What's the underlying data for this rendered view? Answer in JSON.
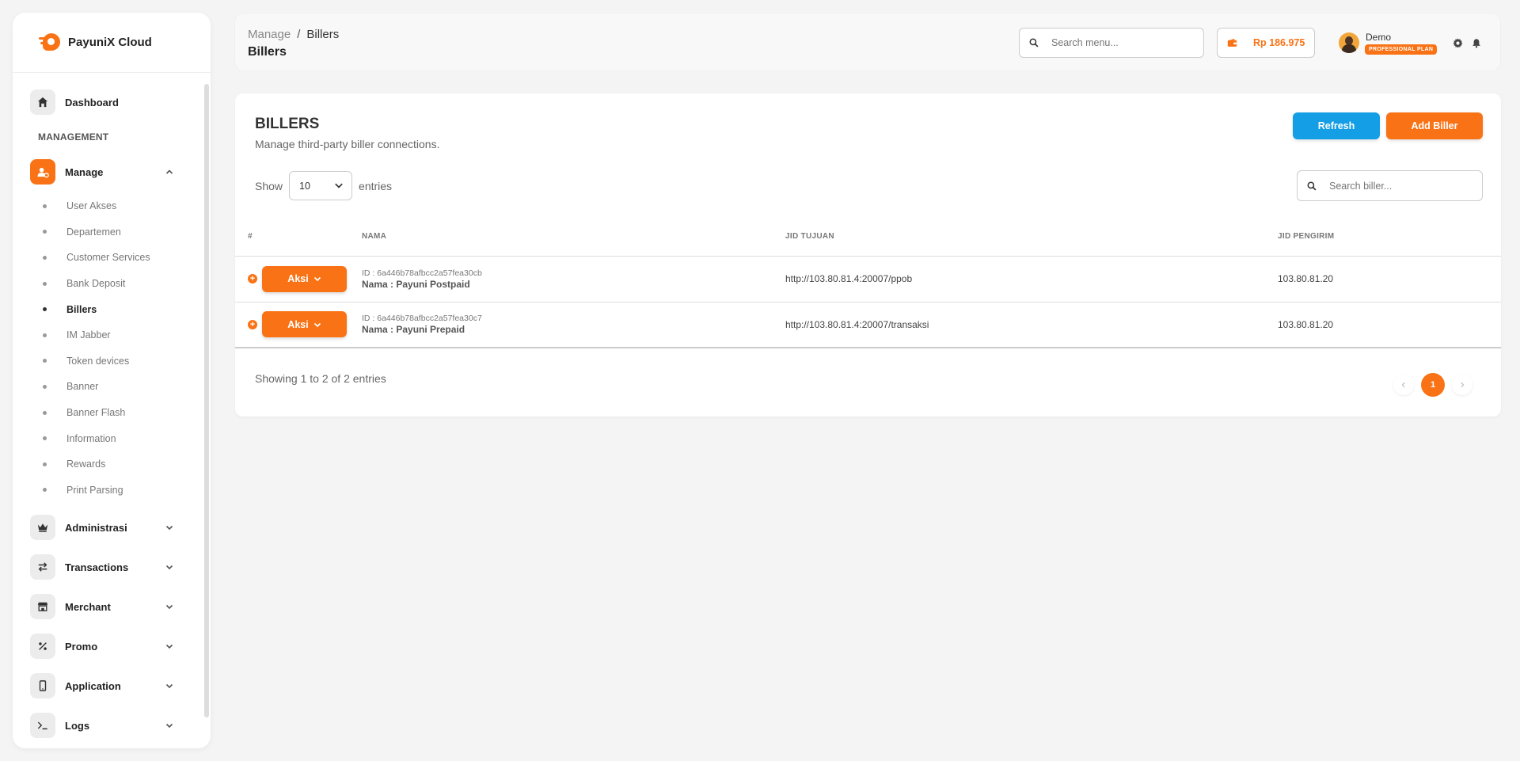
{
  "brand": {
    "name": "PayuniX Cloud"
  },
  "sidebar": {
    "dashboard": "Dashboard",
    "section_title": "MANAGEMENT",
    "manage": {
      "label": "Manage",
      "items": [
        "User Akses",
        "Departemen",
        "Customer Services",
        "Bank Deposit",
        "Billers",
        "IM Jabber",
        "Token devices",
        "Banner",
        "Banner Flash",
        "Information",
        "Rewards",
        "Print Parsing"
      ]
    },
    "groups": [
      {
        "label": "Administrasi",
        "icon": "crown-icon"
      },
      {
        "label": "Transactions",
        "icon": "transfer-icon"
      },
      {
        "label": "Merchant",
        "icon": "store-icon"
      },
      {
        "label": "Promo",
        "icon": "percent-icon"
      },
      {
        "label": "Application",
        "icon": "mobile-icon"
      },
      {
        "label": "Logs",
        "icon": "terminal-icon"
      }
    ]
  },
  "header": {
    "breadcrumb": {
      "parent": "Manage",
      "separator": "/",
      "current": "Billers"
    },
    "title": "Billers",
    "search_placeholder": "Search menu...",
    "balance": "Rp 186.975",
    "user_name": "Demo",
    "plan": "PROFESSIONAL PLAN"
  },
  "card": {
    "title": "BILLERS",
    "subtitle": "Manage third-party biller connections.",
    "refresh_label": "Refresh",
    "add_label": "Add Biller",
    "show_label": "Show",
    "entries_value": "10",
    "entries_label": "entries",
    "search_placeholder": "Search biller..."
  },
  "table": {
    "headers": [
      "#",
      "NAMA",
      "JID TUJUAN",
      "JID PENGIRIM"
    ],
    "action_label": "Aksi",
    "rows": [
      {
        "id": "ID : 6a446b78afbcc2a57fea30cb",
        "name": "Nama : Payuni Postpaid",
        "jid_tujuan": "http://103.80.81.4:20007/ppob",
        "jid_pengirim": "103.80.81.20"
      },
      {
        "id": "ID : 6a446b78afbcc2a57fea30c7",
        "name": "Nama : Payuni Prepaid",
        "jid_tujuan": "http://103.80.81.4:20007/transaksi",
        "jid_pengirim": "103.80.81.20"
      }
    ]
  },
  "footer": {
    "showing": "Showing 1 to 2 of 2 entries",
    "current_page": "1"
  },
  "colors": {
    "accent": "#f97316",
    "refresh": "#149ee6"
  }
}
